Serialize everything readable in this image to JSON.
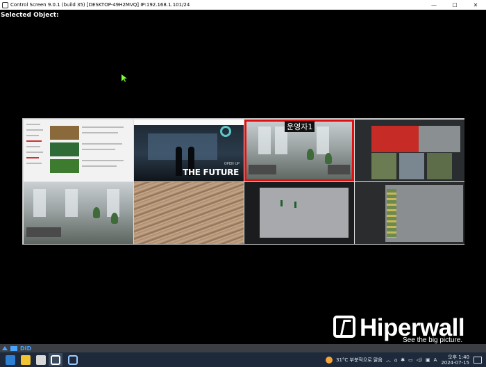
{
  "window": {
    "title": "Control Screen 9.0.1 (build 35) [DESKTOP-49H2MVQ] IP:192.168.1.101/24",
    "minimize": "—",
    "maximize": "☐",
    "close": "✕"
  },
  "selected_object": {
    "label": "Selected Object:"
  },
  "tiles": [
    {
      "name": "news-page"
    },
    {
      "name": "open-up-the-future",
      "small_text": "OPEN UP",
      "big_text": "THE FUTURE"
    },
    {
      "name": "office-camera-1",
      "label": "운영자1",
      "selected": true
    },
    {
      "name": "traffic-dashboard"
    },
    {
      "name": "office-camera-2"
    },
    {
      "name": "aerial-terrain"
    },
    {
      "name": "street-camera"
    },
    {
      "name": "road-aerial"
    }
  ],
  "logo": {
    "word": "Hiperwall",
    "tagline": "See the big picture.",
    "mark": "®"
  },
  "did_bar": {
    "label": "DID"
  },
  "taskbar": {
    "weather": "31°C 부분적으로 맑음",
    "time": "오후 1:40",
    "date": "2024-07-15",
    "ime": "A"
  },
  "colors": {
    "selection": "#e01010",
    "accent": "#4aa3ff"
  }
}
